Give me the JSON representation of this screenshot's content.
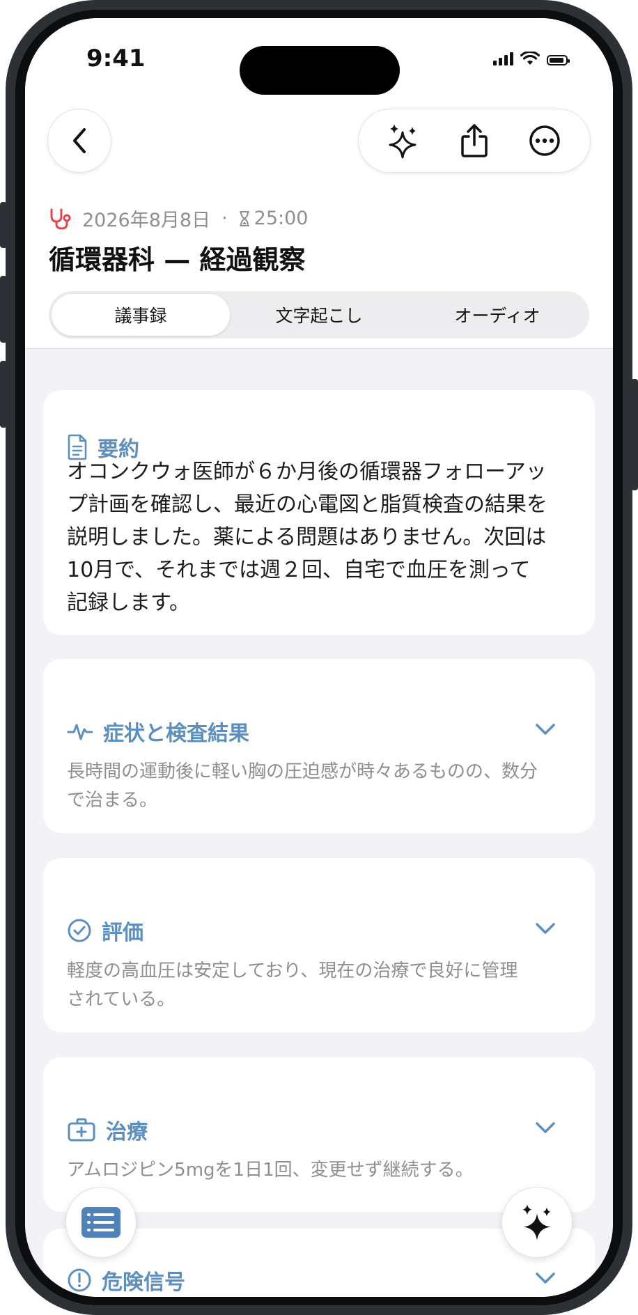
{
  "status_bar": {
    "time": "9:41"
  },
  "header": {
    "back_icon": "chevron-left-icon",
    "actions": [
      "sparkles-icon",
      "share-icon",
      "more-icon"
    ],
    "date": "2026年8月8日",
    "separator": "·",
    "duration": "25:00",
    "title": "循環器科 — 経過観察"
  },
  "tabs": [
    {
      "label": "議事録",
      "active": true
    },
    {
      "label": "文字起こし",
      "active": false
    },
    {
      "label": "オーディオ",
      "active": false
    }
  ],
  "summary": {
    "heading": "要約",
    "icon": "document-icon",
    "lines": [
      "オコンクウォ医師が６か月後の循環器フォローアッ",
      "プ計画を確認し、最近の心電図と脂質検査の結果を",
      "説明しました。薬による問題はありません。次回は",
      "10月で、それまでは週２回、自宅で血圧を測って",
      "記録します。"
    ]
  },
  "sections": [
    {
      "heading": "症状と検査結果",
      "icon": "pulse-icon",
      "body": [
        "長時間の運動後に軽い胸の圧迫感が時々あるものの、数分",
        "で治まる。"
      ]
    },
    {
      "heading": "評価",
      "icon": "checkmark-circle-icon",
      "body": [
        "軽度の高血圧は安定しており、現在の治療で良好に管理",
        "されている。"
      ]
    },
    {
      "heading": "治療",
      "icon": "medkit-icon",
      "body": [
        "アムロジピン5mgを1日1回、変更せず継続する。"
      ]
    },
    {
      "heading": "危険信号",
      "icon": "alert-circle-icon",
      "body": []
    }
  ],
  "colors": {
    "accent": "#5b8fbf",
    "stethoscope": "#e0474c",
    "background": "#f2f2f7"
  }
}
